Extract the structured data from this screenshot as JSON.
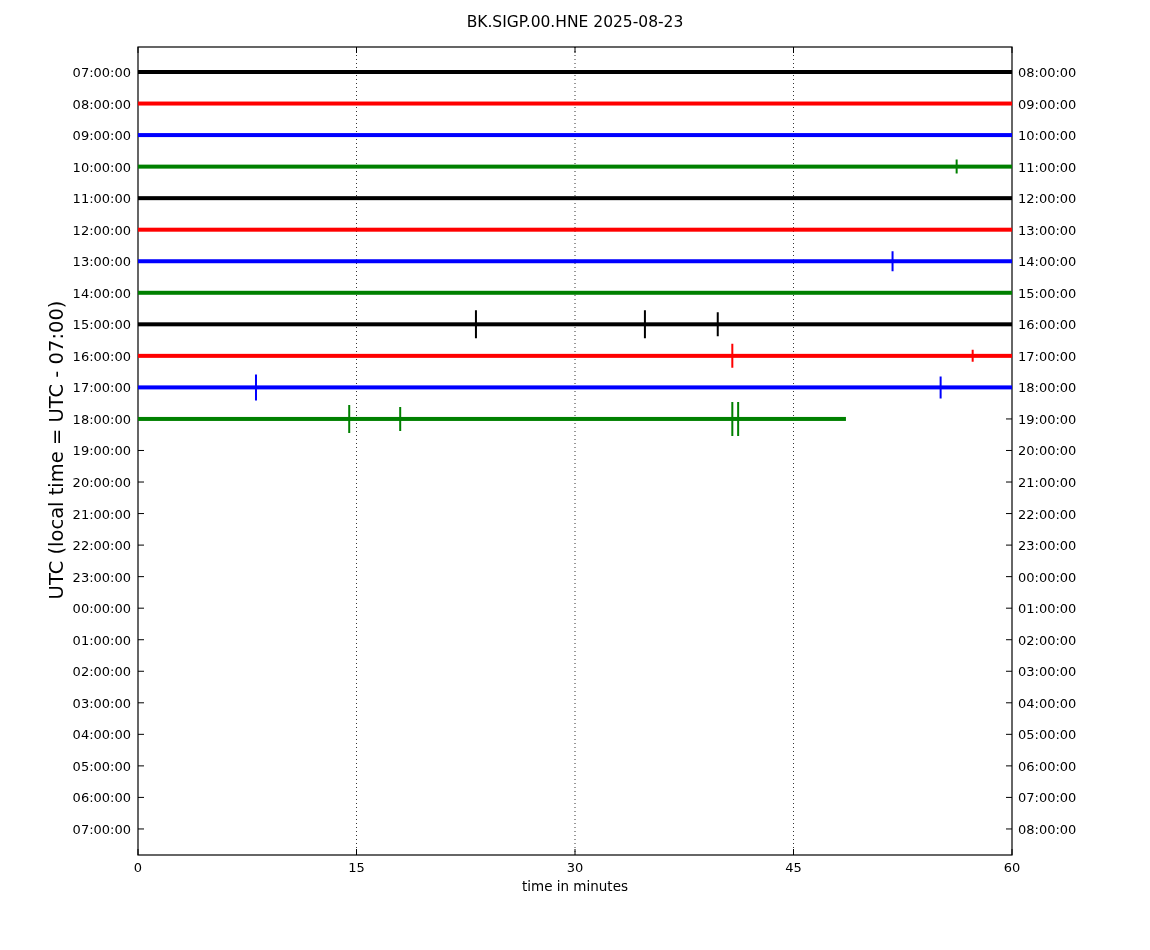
{
  "chart": {
    "title": "BK.SIGP.00.HNE 2025-08-23",
    "xlabel": "time in minutes",
    "ylabel": "UTC (local time = UTC - 07:00)",
    "xticks": [
      "0",
      "15",
      "30",
      "45",
      "60"
    ],
    "left_labels": [
      "07:00:00",
      "08:00:00",
      "09:00:00",
      "10:00:00",
      "11:00:00",
      "12:00:00",
      "13:00:00",
      "14:00:00",
      "15:00:00",
      "16:00:00",
      "17:00:00",
      "18:00:00",
      "19:00:00",
      "20:00:00",
      "21:00:00",
      "22:00:00",
      "23:00:00",
      "00:00:00",
      "01:00:00",
      "02:00:00",
      "03:00:00",
      "04:00:00",
      "05:00:00",
      "06:00:00",
      "07:00:00"
    ],
    "right_labels": [
      "08:00:00",
      "09:00:00",
      "10:00:00",
      "11:00:00",
      "12:00:00",
      "13:00:00",
      "14:00:00",
      "15:00:00",
      "16:00:00",
      "17:00:00",
      "18:00:00",
      "19:00:00",
      "20:00:00",
      "21:00:00",
      "22:00:00",
      "23:00:00",
      "00:00:00",
      "01:00:00",
      "02:00:00",
      "03:00:00",
      "04:00:00",
      "05:00:00",
      "06:00:00",
      "07:00:00",
      "08:00:00"
    ],
    "traces": [
      {
        "color": "#000000",
        "level": 1
      },
      {
        "color": "#ff0000",
        "level": 1
      },
      {
        "color": "#0000ff",
        "level": 1
      },
      {
        "color": "#008000",
        "level": 1
      },
      {
        "color": "#000000",
        "level": 1
      },
      {
        "color": "#ff0000",
        "level": 1
      },
      {
        "color": "#0000ff",
        "level": 1
      },
      {
        "color": "#008000",
        "level": 1
      },
      {
        "color": "#000000",
        "level": 1
      },
      {
        "color": "#ff0000",
        "level": 1
      },
      {
        "color": "#0000ff",
        "level": 1
      },
      {
        "color": "#008000",
        "level": 0.81
      }
    ]
  }
}
